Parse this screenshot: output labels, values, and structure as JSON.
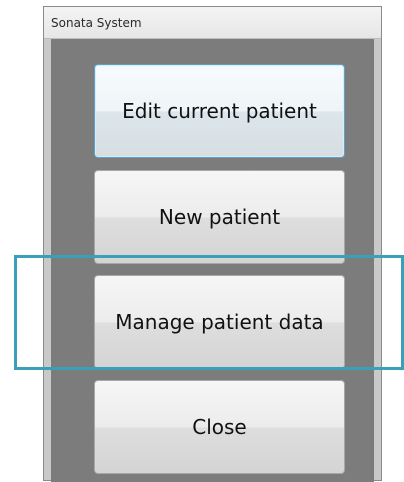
{
  "window": {
    "title": "Sonata System"
  },
  "buttons": {
    "edit_current_patient": "Edit current patient",
    "new_patient": "New patient",
    "manage_patient_data": "Manage patient data",
    "close": "Close"
  },
  "colors": {
    "highlight_outline": "#3a9fb8",
    "content_background": "#7c7c7c"
  }
}
